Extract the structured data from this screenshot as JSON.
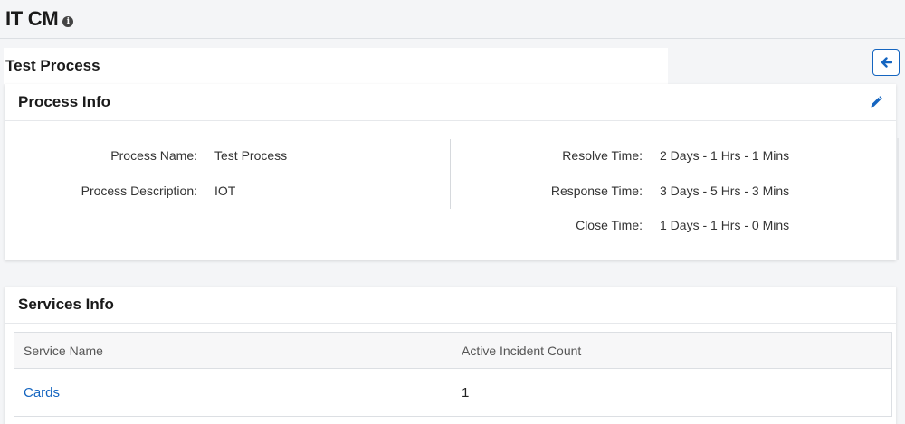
{
  "header": {
    "title": "IT CM",
    "info_icon": "i"
  },
  "process": {
    "title": "Test Process"
  },
  "process_info": {
    "title": "Process Info",
    "left": [
      {
        "label": "Process Name:",
        "value": "Test Process"
      },
      {
        "label": "Process Description:",
        "value": "IOT"
      }
    ],
    "right": [
      {
        "label": "Resolve Time:",
        "value": "2 Days - 1 Hrs - 1 Mins"
      },
      {
        "label": "Response Time:",
        "value": "3 Days - 5 Hrs - 3 Mins"
      },
      {
        "label": "Close Time:",
        "value": "1 Days - 1 Hrs - 0 Mins"
      }
    ]
  },
  "services_info": {
    "title": "Services Info",
    "columns": [
      "Service Name",
      "Active Incident Count"
    ],
    "rows": [
      {
        "service": "Cards",
        "count": "1"
      }
    ]
  },
  "colors": {
    "accent": "#1565c0",
    "background": "#f4f5f7"
  },
  "icons": {
    "back": "arrow-left-icon",
    "edit": "pencil-icon",
    "info": "info-icon"
  }
}
